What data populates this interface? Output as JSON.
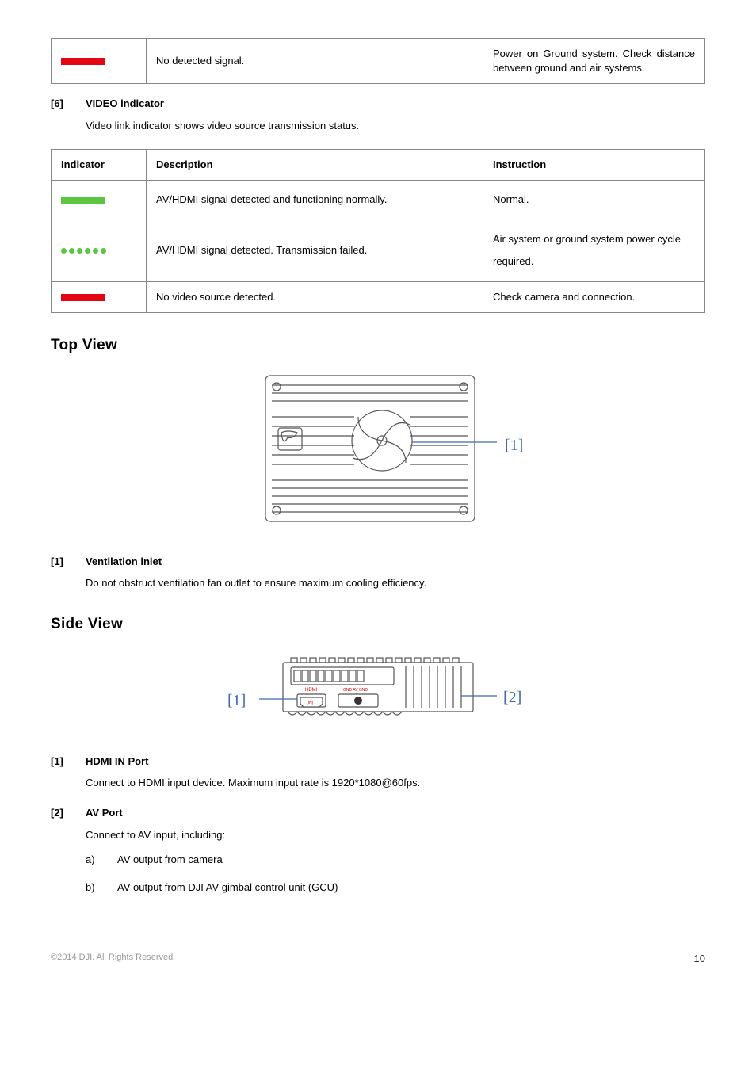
{
  "toptable": {
    "desc": "No detected signal.",
    "instr": "Power on Ground system. Check distance between ground and air systems."
  },
  "sec6": {
    "num": "[6]",
    "title": "VIDEO indicator",
    "intro": "Video link indicator shows video source transmission status."
  },
  "vid_table": {
    "h_ind": "Indicator",
    "h_desc": "Description",
    "h_instr": "Instruction",
    "r1_desc": "AV/HDMI signal detected and functioning normally.",
    "r1_instr": "Normal.",
    "r2_desc": "AV/HDMI signal detected. Transmission failed.",
    "r2_instr": "Air system or ground system power cycle required.",
    "r3_desc": "No video source detected.",
    "r3_instr": "Check camera and connection."
  },
  "topview": {
    "heading": "Top View",
    "callout1": "[1]",
    "sec1_num": "[1]",
    "sec1_title": "Ventilation inlet",
    "sec1_body": "Do not obstruct ventilation fan outlet to ensure maximum cooling efficiency."
  },
  "sideview": {
    "heading": "Side View",
    "callout1": "[1]",
    "callout2": "[2]",
    "sec1_num": "[1]",
    "sec1_title": "HDMI IN Port",
    "sec1_body": "Connect to HDMI input device. Maximum input rate is 1920*1080@60fps.",
    "sec2_num": "[2]",
    "sec2_title": "AV Port",
    "sec2_body": "Connect to AV input, including:",
    "li_a_key": "a)",
    "li_a_txt": "AV output from camera",
    "li_b_key": "b)",
    "li_b_txt": "AV output from DJI AV gimbal control unit (GCU)"
  },
  "footer": {
    "copy": "©2014 DJI. All Rights Reserved.",
    "page": "10"
  }
}
